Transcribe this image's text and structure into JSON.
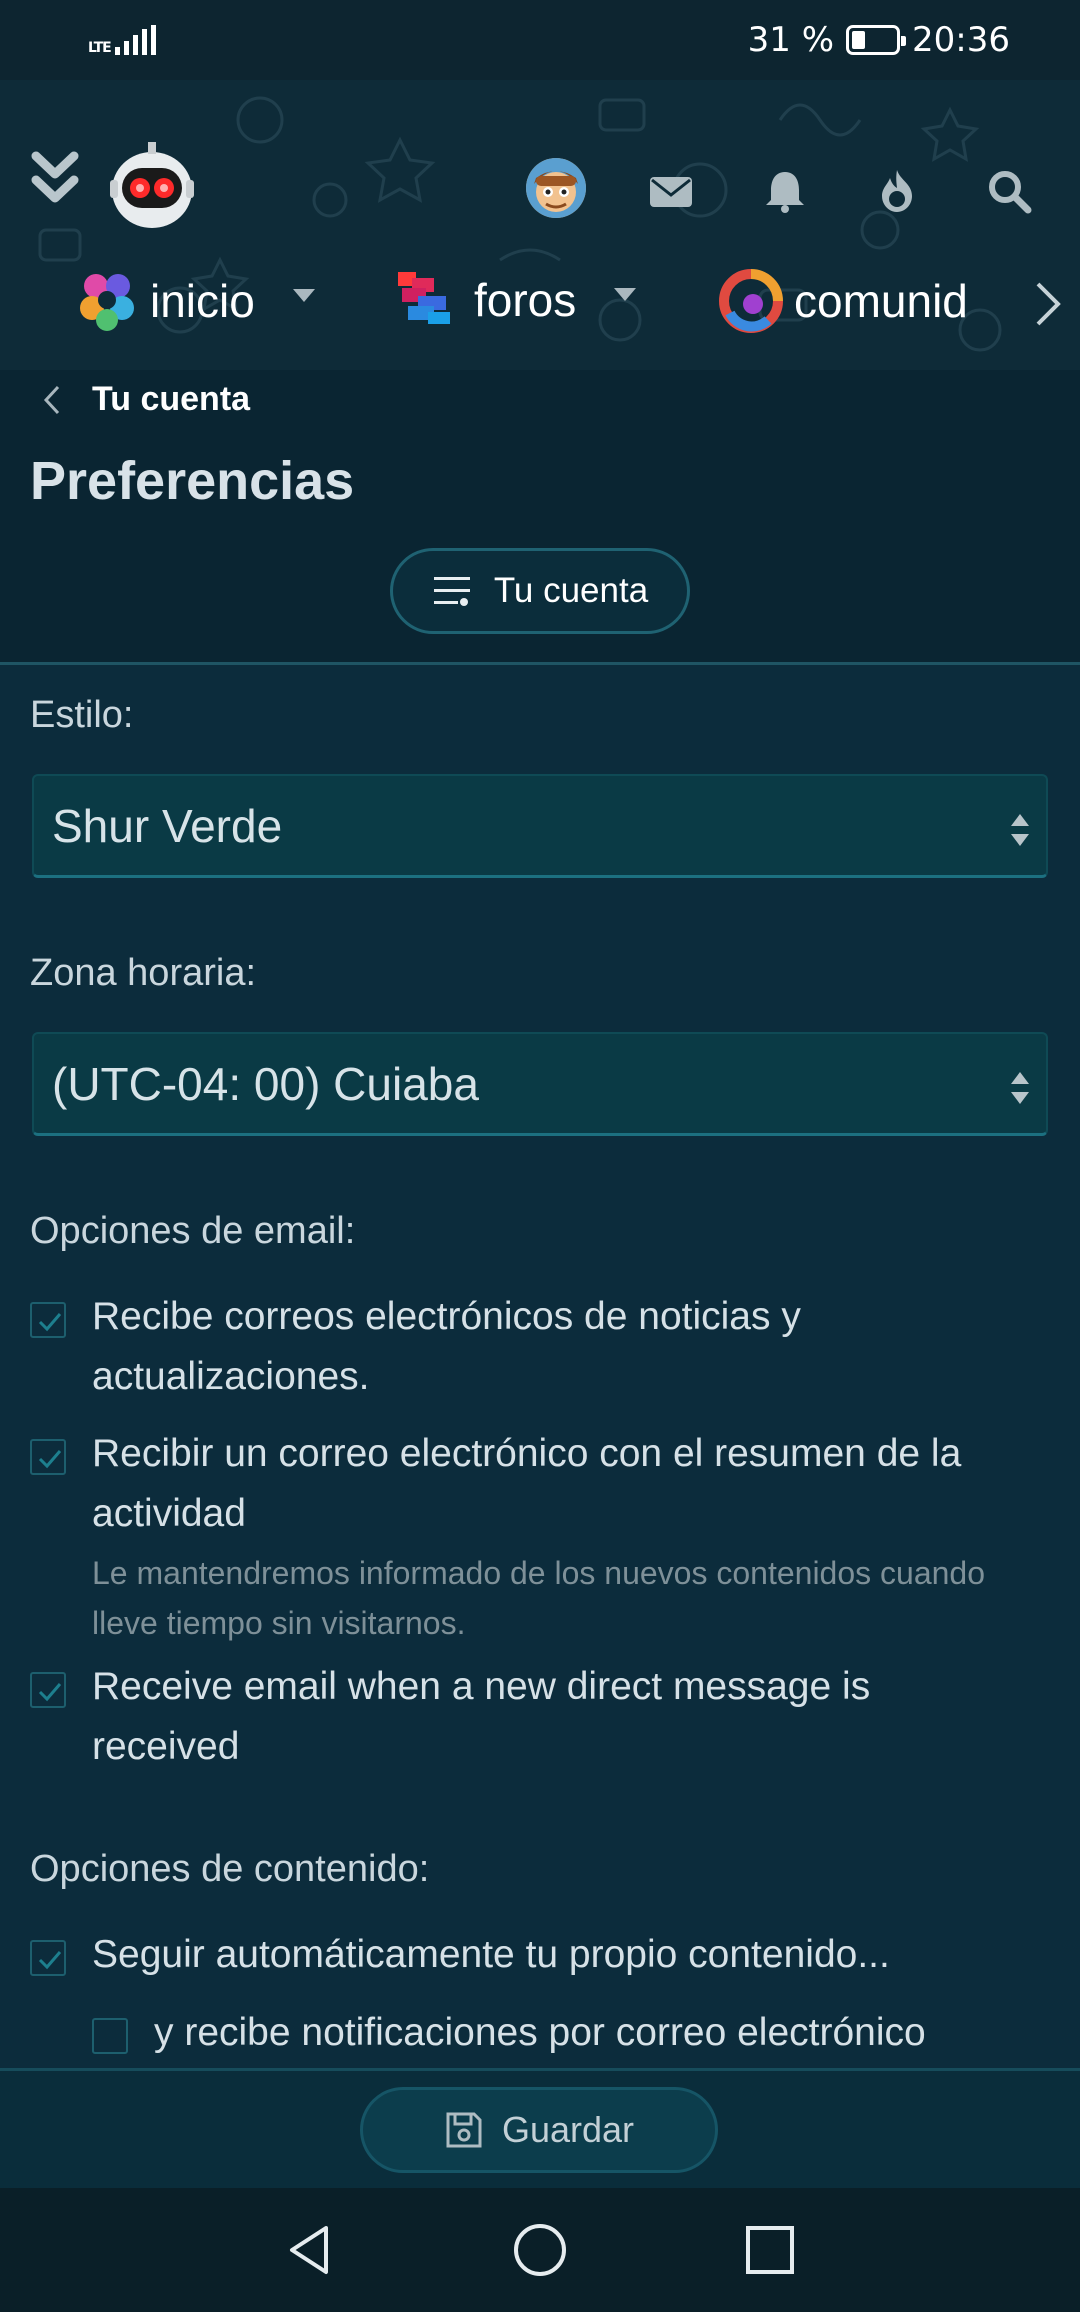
{
  "status_bar": {
    "network": "LTE",
    "battery": "31 %",
    "battery_level": 0.31,
    "time": "20:36"
  },
  "header": {
    "icons": [
      "collapse-icon",
      "robot-logo-icon",
      "avatar",
      "mail-icon",
      "bell-icon",
      "fire-icon",
      "search-icon"
    ],
    "nav": [
      {
        "label": "inicio",
        "has_dropdown": true
      },
      {
        "label": "foros",
        "has_dropdown": true
      },
      {
        "label": "comunid",
        "has_dropdown": false
      }
    ]
  },
  "breadcrumb": {
    "label": "Tu cuenta"
  },
  "page": {
    "title": "Preferencias",
    "menu_button": "Tu cuenta"
  },
  "form": {
    "style_label": "Estilo:",
    "style_value": "Shur Verde",
    "timezone_label": "Zona horaria:",
    "timezone_value": "(UTC-04: 00) Cuiaba",
    "email_section": "Opciones de email:",
    "email_options": [
      {
        "text": "Recibe correos electrónicos de noticias y actualizaciones.",
        "checked": true
      },
      {
        "text": "Recibir un correo electrónico con el resumen de la actividad",
        "hint": "Le mantendremos informado de los nuevos contenidos cuando lleve tiempo sin visitarnos.",
        "checked": true
      },
      {
        "text": "Receive email when a new direct message is received",
        "checked": true
      }
    ],
    "content_section": "Opciones de contenido:",
    "content_options": [
      {
        "text": "Seguir automáticamente tu propio contenido...",
        "checked": true
      },
      {
        "text": "y recibe notificaciones por correo electrónico",
        "checked": false
      }
    ],
    "save_label": "Guardar"
  },
  "colors": {
    "background": "#0c2c3c",
    "header": "#0e2b38",
    "accent": "#1d5f6e",
    "check": "#1d7f8e"
  }
}
